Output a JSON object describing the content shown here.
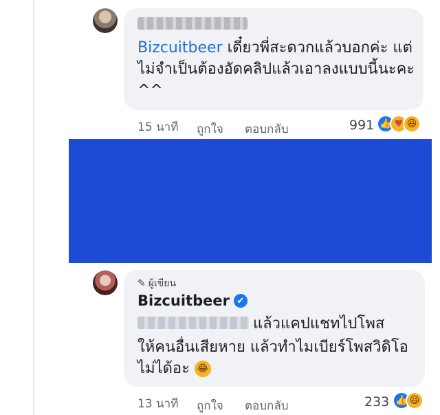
{
  "comment1": {
    "mention": "Bizcuitbeer",
    "text": " เดี๋ยวพี่สะดวกแล้วบอกค่ะ แต่ไม่จำเป็นต้องอัดคลิปแล้วเอาลงแบบนี้นะคะ ^^",
    "time": "15 นาที",
    "like_label": "ถูกใจ",
    "reply_label": "ตอบกลับ",
    "reaction_count": "991",
    "reactions": [
      "like-icon",
      "care-icon",
      "laugh-icon"
    ]
  },
  "comment2": {
    "author_badge": "ผู้เขียน",
    "author_name": "Bizcuitbeer",
    "text_line1": "แล้วแคปแชทไปโพส",
    "text_rest": "ให้คนอื่นเสียหาย แล้วทำไมเบียร์โพสวิดิโอไม่ได้อะ",
    "time": "13 นาที",
    "like_label": "ถูกใจ",
    "reply_label": "ตอบกลับ",
    "reaction_count": "233",
    "reactions": [
      "like-icon",
      "laugh-icon"
    ]
  },
  "colors": {
    "mention": "#216fdb",
    "redaction_block": "#1e4bd6",
    "bubble": "#f0f2f5"
  }
}
